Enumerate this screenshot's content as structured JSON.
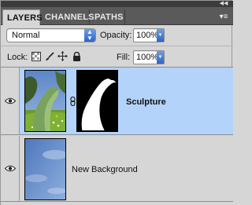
{
  "tabs": [
    {
      "label": "LAYERS",
      "active": true
    },
    {
      "label": "CHANNELS",
      "active": false
    },
    {
      "label": "PATHS",
      "active": false
    }
  ],
  "blend": {
    "mode": "Normal",
    "opacity_label": "Opacity:",
    "opacity_value": "100%"
  },
  "lock": {
    "label": "Lock:",
    "icons": [
      "lock-transparent-pixels-icon",
      "lock-image-pixels-icon",
      "lock-position-icon",
      "lock-all-icon"
    ]
  },
  "fill": {
    "label": "Fill:",
    "value": "100%"
  },
  "layers": [
    {
      "name": "Sculpture",
      "selected": true,
      "visible": true,
      "has_mask": true
    },
    {
      "name": "New Background",
      "selected": false,
      "visible": true,
      "has_mask": false
    }
  ],
  "colors": {
    "selection": "#b3d3fb",
    "tab_bar": "#5a5a5a",
    "panel": "#d6d6d6",
    "dropdown_arrow": "#2f63c4"
  }
}
